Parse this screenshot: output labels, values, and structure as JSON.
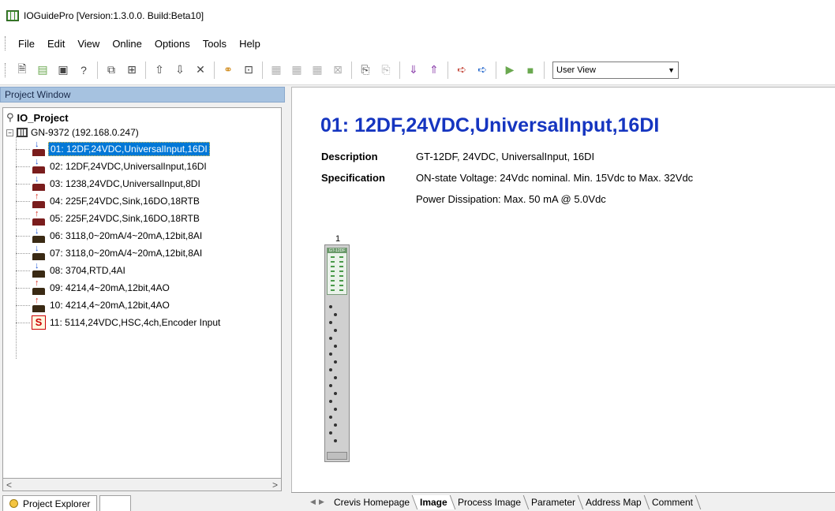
{
  "window": {
    "title": "IOGuidePro [Version:1.3.0.0. Build:Beta10]"
  },
  "menu": [
    "File",
    "Edit",
    "View",
    "Online",
    "Options",
    "Tools",
    "Help"
  ],
  "toolbar": {
    "view_select": "User View",
    "icons": [
      "new-file-icon",
      "open-icon",
      "save-icon",
      "help-icon",
      "separator",
      "add-module-icon",
      "add-multi-module-icon",
      "separator",
      "move-up-icon",
      "move-down-icon",
      "delete-icon",
      "separator",
      "connect-icon",
      "scan-icon",
      "separator",
      "io-disabled-1-icon",
      "io-disabled-2-icon",
      "io-disabled-3-icon",
      "io-disabled-4-icon",
      "separator",
      "copy-icon",
      "paste-icon",
      "separator",
      "download-icon",
      "upload-icon",
      "separator",
      "send-icon",
      "receive-icon",
      "separator",
      "run-icon",
      "stop-icon"
    ]
  },
  "project_window": {
    "header": "Project Window",
    "root": "IO_Project",
    "gateway": "GN-9372 (192.168.0.247)",
    "modules": [
      {
        "label": "01: 12DF,24VDC,UniversalInput,16DI",
        "kind": "di",
        "selected": true
      },
      {
        "label": "02: 12DF,24VDC,UniversalInput,16DI",
        "kind": "di",
        "selected": false
      },
      {
        "label": "03: 1238,24VDC,UniversalInput,8DI",
        "kind": "di",
        "selected": false
      },
      {
        "label": "04: 225F,24VDC,Sink,16DO,18RTB",
        "kind": "do",
        "selected": false
      },
      {
        "label": "05: 225F,24VDC,Sink,16DO,18RTB",
        "kind": "do",
        "selected": false
      },
      {
        "label": "06: 3118,0~20mA/4~20mA,12bit,8AI",
        "kind": "ai",
        "selected": false
      },
      {
        "label": "07: 3118,0~20mA/4~20mA,12bit,8AI",
        "kind": "ai",
        "selected": false
      },
      {
        "label": "08: 3704,RTD,4AI",
        "kind": "ai",
        "selected": false
      },
      {
        "label": "09: 4214,4~20mA,12bit,4AO",
        "kind": "ao",
        "selected": false
      },
      {
        "label": "10: 4214,4~20mA,12bit,4AO",
        "kind": "ao",
        "selected": false
      },
      {
        "label": "11: 5114,24VDC,HSC,4ch,Encoder Input",
        "kind": "hsc",
        "selected": false
      }
    ],
    "hsc_glyph": "S",
    "scroll_left": "<",
    "scroll_right": ">",
    "explorer_tab": "Project Explorer"
  },
  "detail": {
    "title": "01: 12DF,24VDC,UniversalInput,16DI",
    "description_label": "Description",
    "description_value": "GT-12DF, 24VDC, UniversalInput, 16DI",
    "specification_label": "Specification",
    "spec_lines": [
      "ON-state Voltage: 24Vdc nominal. Min. 15Vdc to Max. 32Vdc",
      "Power Dissipation: Max. 50 mA @ 5.0Vdc"
    ],
    "module_number": "1",
    "module_tag": "GT-12DF"
  },
  "tabs": {
    "items": [
      "Crevis Homepage",
      "Image",
      "Process Image",
      "Parameter",
      "Address Map",
      "Comment"
    ],
    "active": "Image",
    "prev_arrow": "◀",
    "next_arrow": "▶"
  }
}
